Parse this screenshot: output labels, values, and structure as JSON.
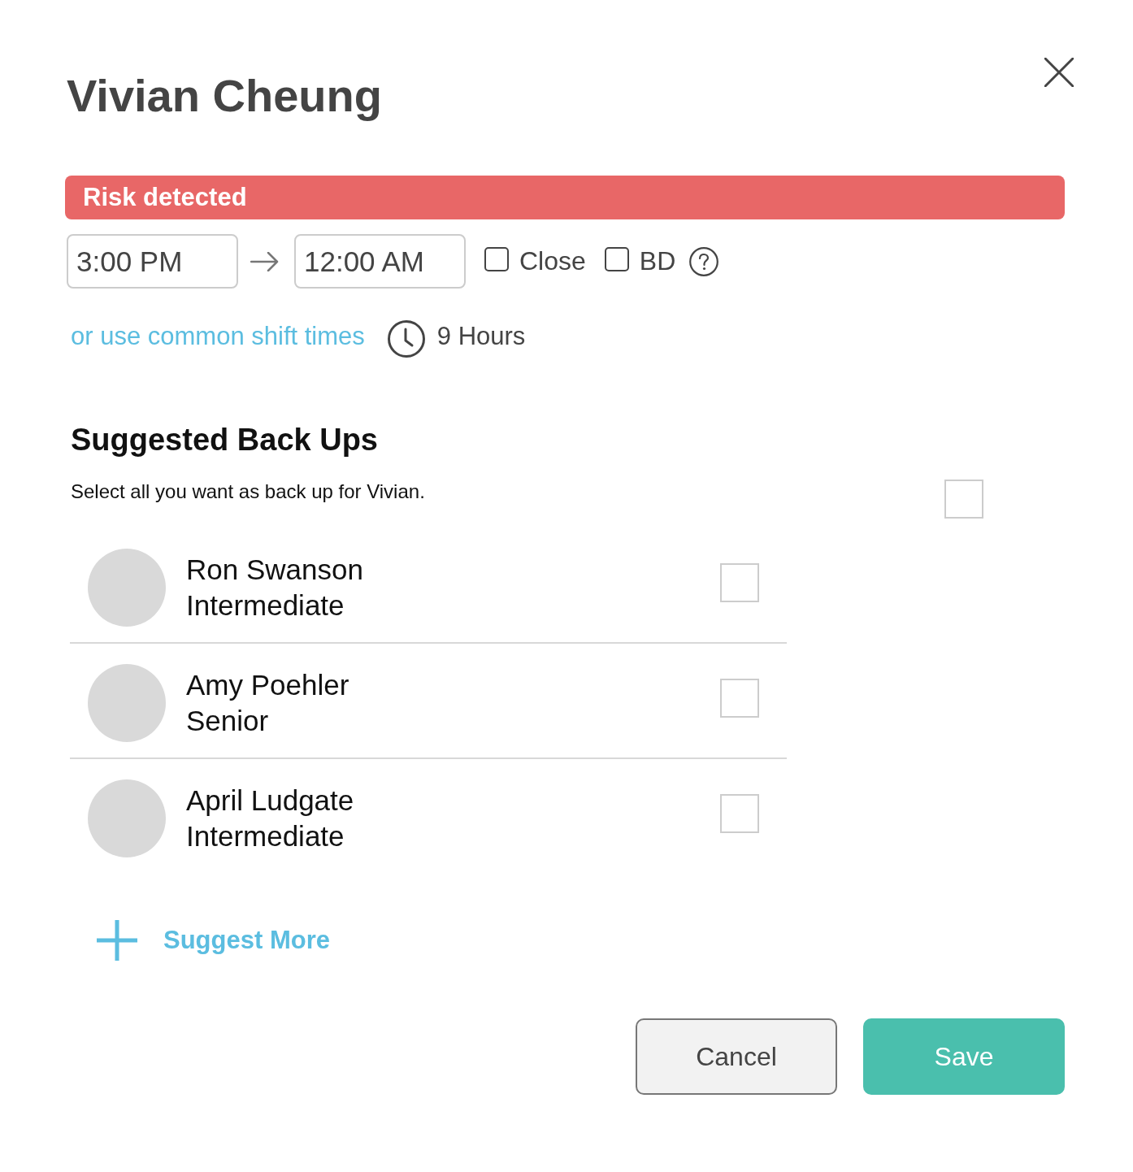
{
  "dialog": {
    "title": "Vivian Cheung",
    "alert": {
      "text": "Risk detected"
    },
    "shift": {
      "start": "3:00 PM",
      "end": "12:00 AM",
      "options": [
        {
          "label": "Close",
          "checked": false
        },
        {
          "label": "BD",
          "checked": false
        }
      ],
      "link": "or use common shift times",
      "duration": "9 Hours"
    }
  },
  "backups": {
    "heading": "Suggested Back Ups",
    "description": "Select all you want as back up for Vivian.",
    "select_all": {
      "checked": false
    },
    "people": [
      {
        "name": "Ron Swanson",
        "role": "Intermediate",
        "checked": false
      },
      {
        "name": "Amy Poehler",
        "role": "Senior",
        "checked": false
      },
      {
        "name": "April Ludgate",
        "role": "Intermediate",
        "checked": false
      }
    ]
  },
  "suggest_more": "Suggest More",
  "buttons": [
    {
      "label": "Cancel",
      "kind": "secondary"
    },
    {
      "label": "Save",
      "kind": "primary"
    }
  ]
}
